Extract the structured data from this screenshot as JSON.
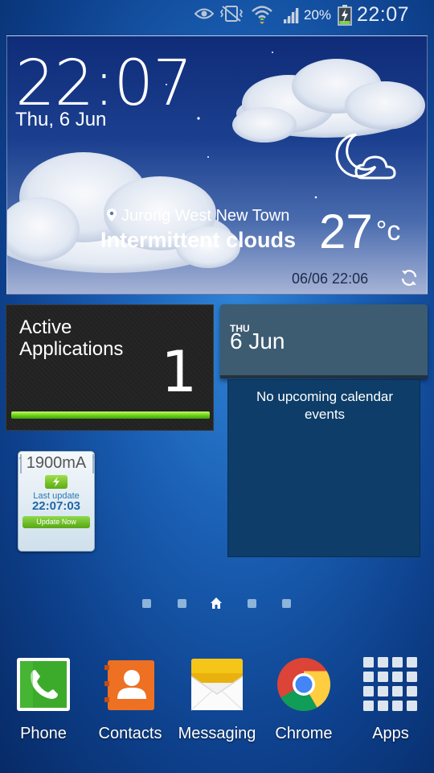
{
  "status_bar": {
    "battery_percent": "20%",
    "clock": "22:07",
    "icons": [
      "eye-icon",
      "vibrate-icon",
      "wifi-icon",
      "signal-icon",
      "battery-charging-icon"
    ]
  },
  "weather": {
    "time": "22:07",
    "date": "Thu, 6 Jun",
    "location": "Jurong West New Town",
    "condition": "Intermittent clouds",
    "temperature": "27",
    "unit": "°c",
    "updated": "06/06 22:06",
    "icons": [
      "location-pin-icon",
      "moon-cloud-icon",
      "refresh-icon"
    ]
  },
  "active_apps": {
    "title": "Active Applications",
    "count": "1",
    "bar_fill": 1.0,
    "bar_color": "#71d61a"
  },
  "calendar": {
    "day_of_week": "THU",
    "date": "6 Jun",
    "empty_message": "No upcoming calendar events"
  },
  "battery_widget": {
    "capacity": "1900mA",
    "last_update_label": "Last update",
    "last_update_time": "22:07:03",
    "button_label": "Update Now"
  },
  "page_indicator": {
    "pages": 5,
    "current": 3
  },
  "dock": {
    "items": [
      {
        "label": "Phone",
        "icon": "phone-icon"
      },
      {
        "label": "Contacts",
        "icon": "contacts-icon"
      },
      {
        "label": "Messaging",
        "icon": "messaging-icon"
      },
      {
        "label": "Chrome",
        "icon": "chrome-icon"
      },
      {
        "label": "Apps",
        "icon": "apps-grid-icon"
      }
    ]
  }
}
